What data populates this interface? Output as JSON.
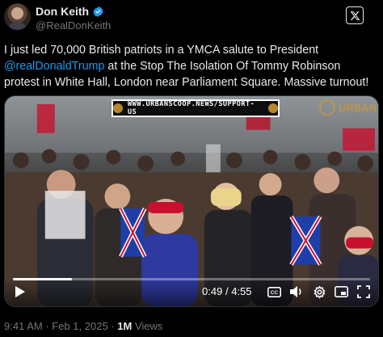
{
  "author": {
    "name": "Don Keith",
    "handle": "@RealDonKeith",
    "verified_icon": "verified-badge-icon",
    "avatar_icon": "avatar"
  },
  "app_icon": "x-logo-icon",
  "tweet": {
    "text_before": "I just led 70,000 British patriots in a YMCA salute to President ",
    "mention": "@realDonaldTrump",
    "text_after": " at the Stop The Isolation Of Tommy Robinson protest in White Hall, London near Parliament Square. Massive turnout!"
  },
  "video": {
    "banner_text": "WWW.URBANSCOOP.NEWS/SUPPORT-US",
    "watermark_text": "URBAN",
    "current_time": "0:49",
    "separator": "/",
    "duration": "4:55",
    "progress": 0.166
  },
  "meta": {
    "time": "9:41 AM",
    "dot": "·",
    "date": "Feb 1, 2025",
    "views_count": "1M",
    "views_label": "Views"
  },
  "colors": {
    "accent": "#1d9bf0",
    "secondary_text": "#71767b",
    "background": "#000000"
  }
}
